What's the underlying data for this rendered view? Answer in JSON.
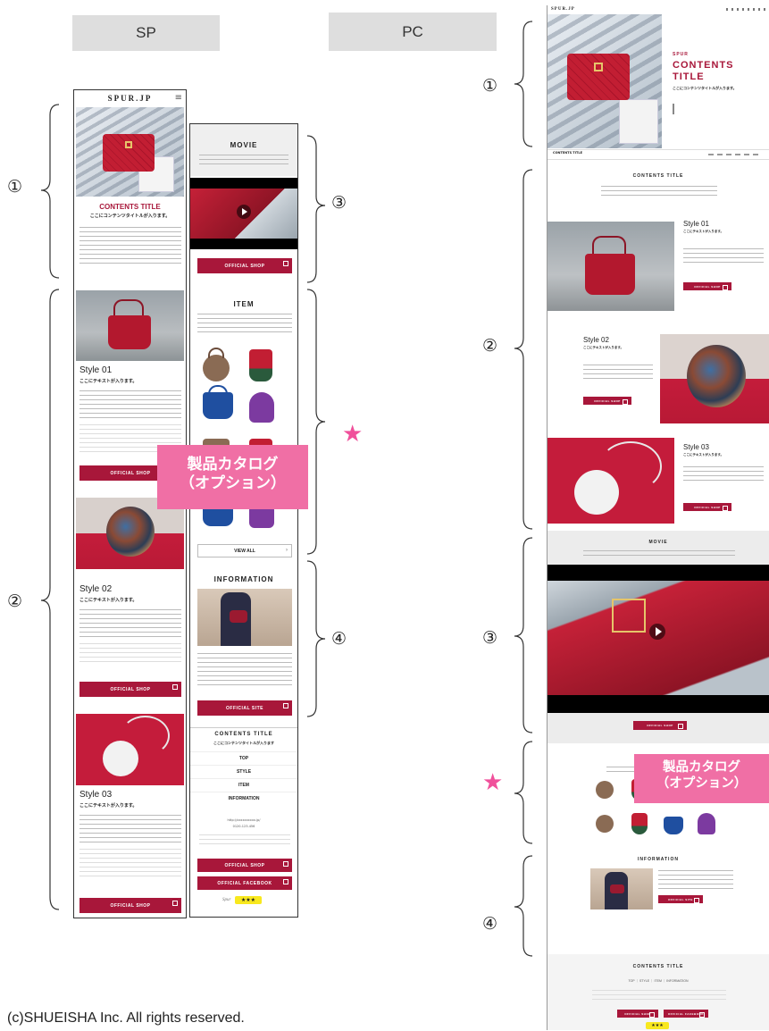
{
  "tabs": {
    "sp": "SP",
    "pc": "PC"
  },
  "markers": {
    "one": "①",
    "two": "②",
    "three": "③",
    "four": "④",
    "star": "★"
  },
  "callout": {
    "line1": "製品カタログ",
    "line2": "（オプション）"
  },
  "copyright": "(c)SHUEISHA Inc. All rights reserved.",
  "sp": {
    "logo": "SPUR.JP",
    "menu_icon": "≡",
    "contents_title": "CONTENTS TITLE",
    "contents_sub": "ここにコンテンツタイトルが入ります。",
    "styles": [
      {
        "title": "Style 01",
        "sub": "ここにテキストが入ります。",
        "button": "OFFICIAL SHOP"
      },
      {
        "title": "Style 02",
        "sub": "ここにテキストが入ります。",
        "button": "OFFICIAL SHOP"
      },
      {
        "title": "Style 03",
        "sub": "ここにテキストが入ります。",
        "button": "OFFICIAL SHOP"
      }
    ]
  },
  "sp2": {
    "movie_heading": "MOVIE",
    "movie_button": "OFFICIAL SHOP",
    "item_heading": "ITEM",
    "view_all": "VIEW ALL",
    "info_heading": "INFORMATION",
    "info_button": "OFFICIAL SITE",
    "footer_title": "CONTENTS TITLE",
    "footer_sub": "ここにコンテンツタイトルが入ります",
    "nav": [
      "TOP",
      "STYLE",
      "ITEM",
      "INFORMATION"
    ],
    "footer_url": "http://xxxxxxxxxx.jp/",
    "footer_tel": "0120-123-456",
    "btn_shop": "OFFICIAL SHOP",
    "btn_facebook": "OFFICIAL FACEBOOK",
    "spur_sign": "Spur"
  },
  "pc": {
    "logo": "SPUR.JP",
    "hero_kicker": "SPUR",
    "hero_title_1": "CONTENTS",
    "hero_title_2": "TITLE",
    "hero_sub": "ここにコンテンツタイトルが入ります。",
    "nav_left": "CONTENTS TITLE",
    "section_title": "CONTENTS TITLE",
    "styles": [
      {
        "title": "Style 01",
        "sub": "ここにテキストが入ります。",
        "button": "OFFICIAL SHOP"
      },
      {
        "title": "Style 02",
        "sub": "ここにテキストが入ります。",
        "button": "OFFICIAL SHOP"
      },
      {
        "title": "Style 03",
        "sub": "ここにテキストが入ります。",
        "button": "OFFICIAL SHOP"
      }
    ],
    "movie_heading": "MOVIE",
    "movie_button": "OFFICIAL SHOP",
    "info_heading": "INFORMATION",
    "info_button": "OFFICIAL SITE",
    "footer_title": "CONTENTS TITLE",
    "footer_nav": "TOP ｜ STYLE ｜ ITEM ｜ INFORMATION",
    "btn_shop": "OFFICIAL SHOP",
    "btn_facebook": "OFFICIAL FACEBOOK"
  },
  "colors": {
    "brand_red": "#a8173a",
    "callout_pink": "#f06fa5",
    "star_pink": "#f0509b",
    "tab_gray": "#dedede"
  }
}
